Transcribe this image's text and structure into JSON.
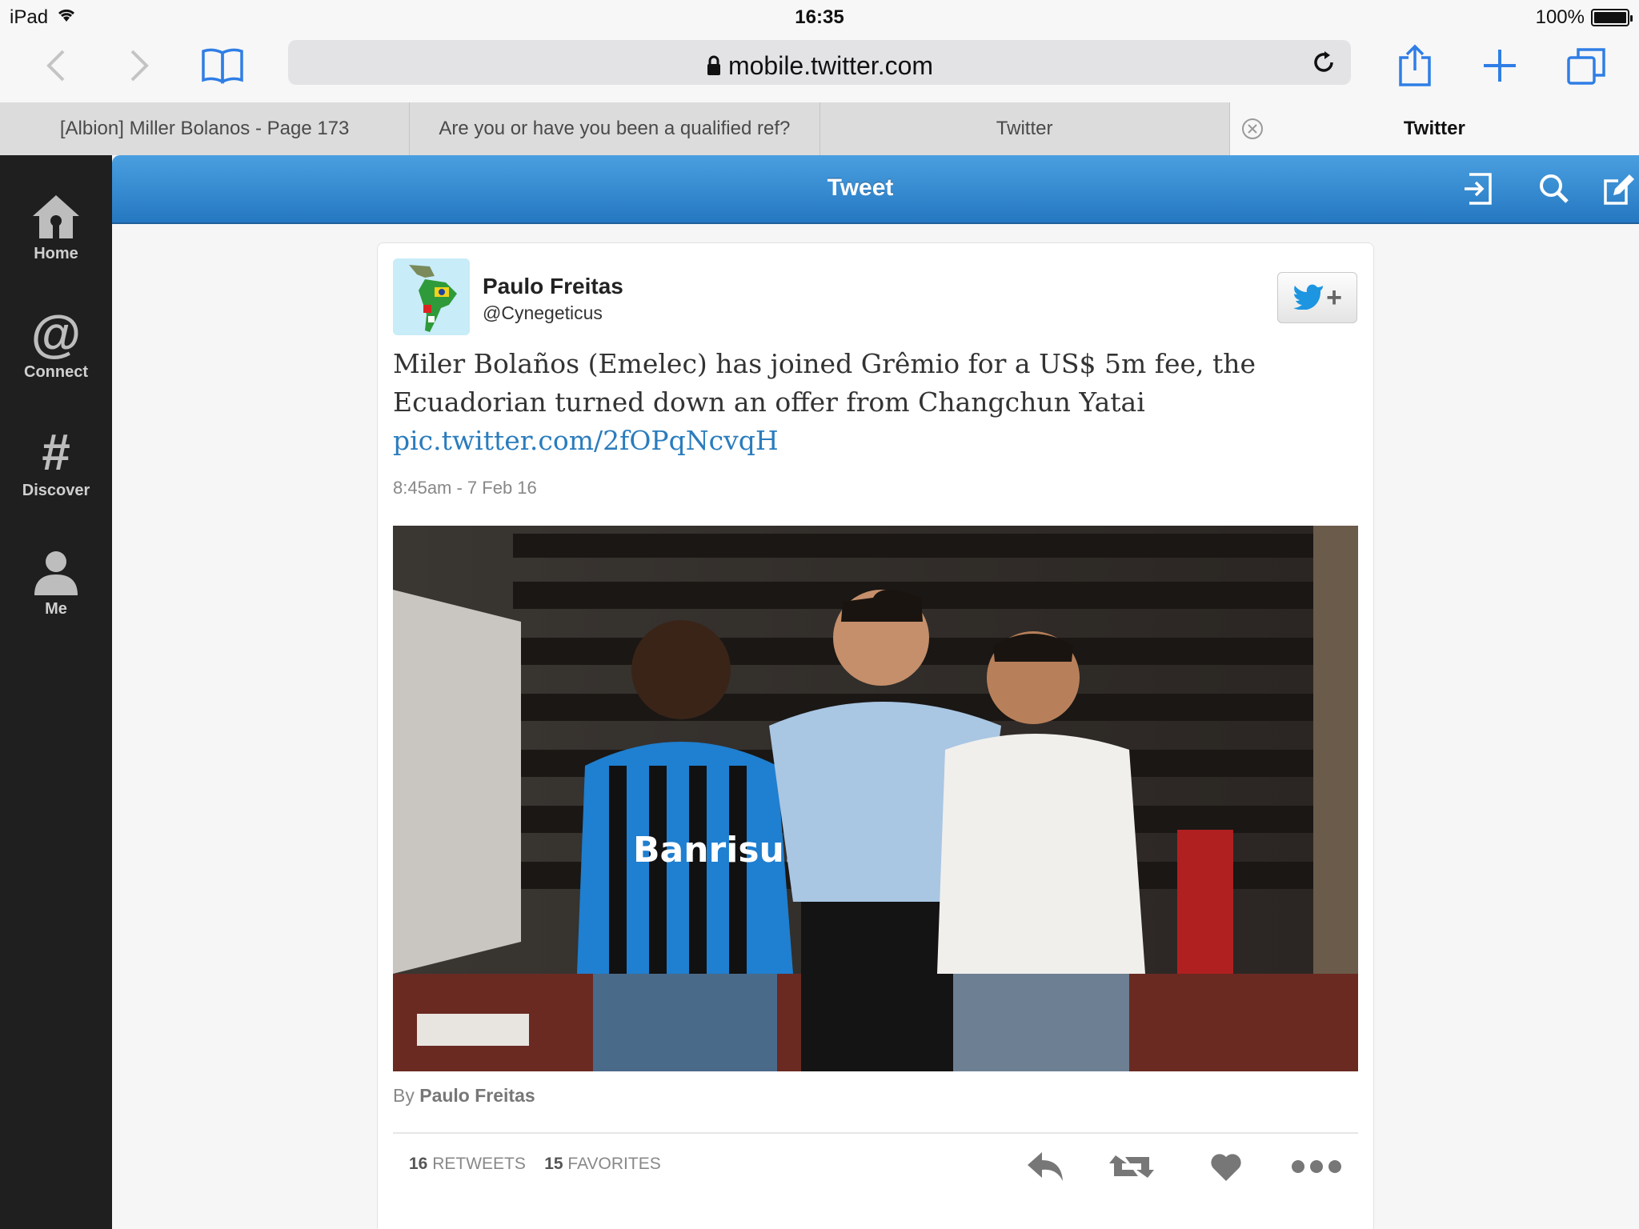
{
  "status_bar": {
    "device": "iPad",
    "time": "16:35",
    "battery": "100%"
  },
  "browser": {
    "url": "mobile.twitter.com",
    "tabs": [
      {
        "label": "[Albion] Miller Bolanos - Page 173"
      },
      {
        "label": "Are you or have you been a qualified ref?"
      },
      {
        "label": "Twitter"
      },
      {
        "label": "Twitter"
      }
    ]
  },
  "sidebar": {
    "items": [
      {
        "label": "Home",
        "icon": "home-icon"
      },
      {
        "label": "Connect",
        "icon": "at-icon"
      },
      {
        "label": "Discover",
        "icon": "hashtag-icon"
      },
      {
        "label": "Me",
        "icon": "person-icon"
      }
    ]
  },
  "header": {
    "title": "Tweet"
  },
  "tweet": {
    "name": "Paulo Freitas",
    "handle": "@Cynegeticus",
    "text": "Miler Bolaños (Emelec) has joined Grêmio for a US$ 5m fee, the Ecuadorian turned down an offer from Changchun Yatai",
    "link": "pic.twitter.com/2fOPqNcvqH",
    "timestamp": "8:45am - 7 Feb 16",
    "credit_prefix": "By",
    "credit_name": "Paulo Freitas",
    "retweets": "16",
    "retweets_label": "RETWEETS",
    "favorites": "15",
    "favorites_label": "FAVORITES",
    "jersey_text": "Banrisul"
  },
  "colors": {
    "twitter_blue": "#2578c1",
    "link": "#2a7cbd",
    "sidebar": "#1f1f1f"
  }
}
